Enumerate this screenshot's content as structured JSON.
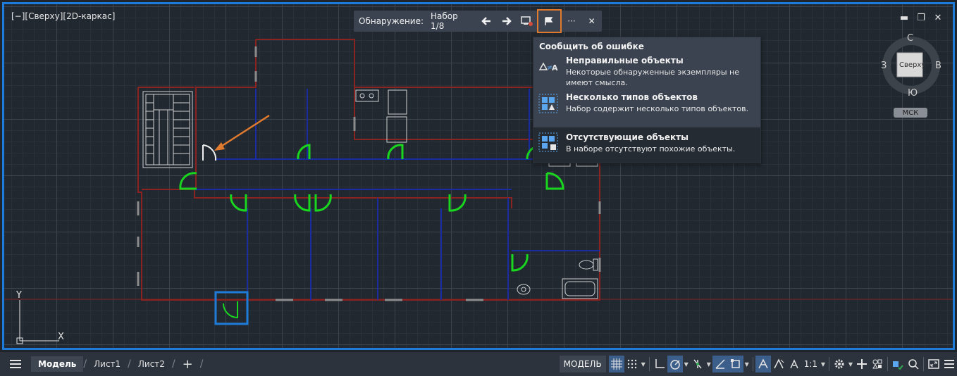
{
  "viewport": {
    "label": "[−][Сверху][2D-каркас]"
  },
  "window_controls": {
    "minimize": "▬",
    "restore": "❐",
    "close": "✕"
  },
  "detection_bar": {
    "label": "Обнаружение:",
    "set": "Набор 1/8",
    "prev_icon": "arrow-left-icon",
    "next_icon": "arrow-right-icon",
    "more": "···",
    "close": "✕"
  },
  "report_menu": {
    "title": "Сообщить об ошибке",
    "items": [
      {
        "title": "Неправильные объекты",
        "desc": "Некоторые обнаруженные экземпляры не имеют смысла.",
        "icon": "wrong-objects-icon"
      },
      {
        "title": "Несколько типов объектов",
        "desc": "Набор содержит несколько типов объектов.",
        "icon": "multiple-types-icon"
      },
      {
        "title": "Отсутствующие объекты",
        "desc": "В наборе отсутствуют похожие объекты.",
        "icon": "missing-objects-icon"
      }
    ]
  },
  "compass": {
    "n": "С",
    "s": "Ю",
    "w": "З",
    "e": "В",
    "cube": "Сверху",
    "ucs": "МСК"
  },
  "ucs_axes": {
    "y": "Y",
    "x": "X"
  },
  "bottom": {
    "tabs": [
      "Модель",
      "Лист1",
      "Лист2"
    ],
    "add": "+",
    "model_button": "МОДЕЛЬ",
    "scale": "1:1"
  },
  "colors": {
    "accent": "#1e7bd7",
    "highlight": "#e07a2e",
    "door": "#19d61e",
    "wall": "#8b2420",
    "blue_line": "#1a2da0"
  }
}
